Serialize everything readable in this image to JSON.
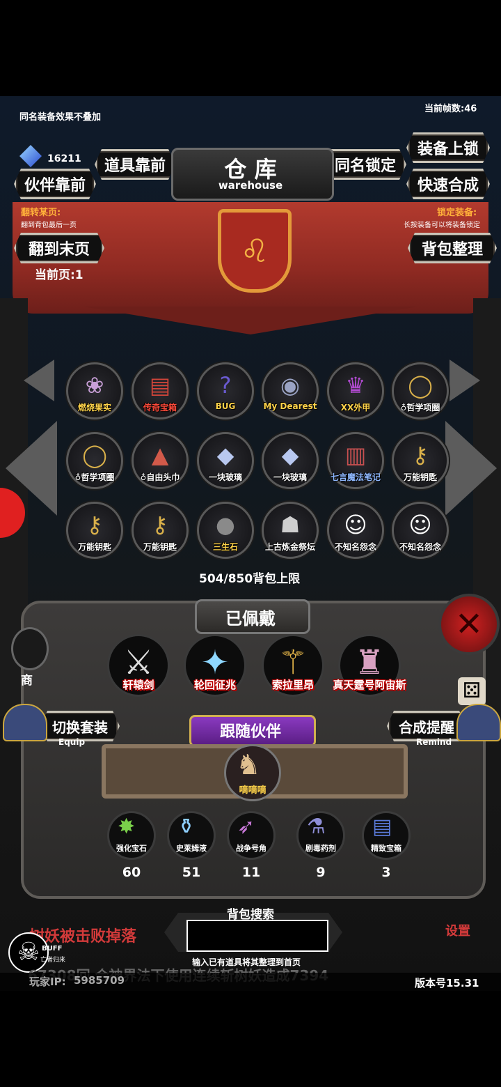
{
  "hud": {
    "note": "同名装备效果不叠加",
    "fps": "当前帧数:46",
    "gem_count": "16211",
    "flip_title": "翻转某页:",
    "flip_desc": "翻到背包最后一页",
    "lock_title": "锁定装备:",
    "lock_desc": "长按装备可以将装备锁定",
    "current_page": "当前页:1",
    "capacity": "504/850背包上限",
    "shop_label": "商",
    "settings_label": "设置",
    "buff_label": "BUFF",
    "buff_sub": "亡者归来",
    "drop_text": "树妖被击败掉落",
    "scroll_text": "67308回 合神界法下使用连续斩树妖造成7394",
    "player_ip_label": "玩家IP:",
    "player_ip": "5985709",
    "version": "版本号15.31"
  },
  "title": {
    "cn": "仓 库",
    "en": "warehouse"
  },
  "buttons": {
    "item_front": "道具靠前",
    "partner_front": "伙伴靠前",
    "same_lock": "同名锁定",
    "equip_lock": "装备上锁",
    "quick_merge": "快速合成",
    "last_page": "翻到末页",
    "sort_bag": "背包整理",
    "switch_set": "切换套装",
    "switch_set_sub": "Equip",
    "merge_remind": "合成提醒",
    "merge_remind_sub": "Remind",
    "follow_partner": "跟随伙伴",
    "equipped": "已佩戴",
    "search_title": "背包搜索",
    "search_hint": "输入已有道具将其整理到首页"
  },
  "inventory": [
    {
      "label": "燃烧果实",
      "icon": "❀",
      "color": "#c9a0d8",
      "label_color": "#ffd34a"
    },
    {
      "label": "传奇宝箱",
      "icon": "▤",
      "color": "#d2453a",
      "label_color": "#ff4a3a"
    },
    {
      "label": "BUG",
      "icon": "?",
      "color": "#6a5ad0",
      "label_color": "#ffd34a"
    },
    {
      "label": "My Dearest",
      "icon": "◉",
      "color": "#9aa3c4",
      "label_color": "#ffd34a"
    },
    {
      "label": "XX外甲",
      "icon": "♛",
      "color": "#b04ad0",
      "label_color": "#ffd34a"
    },
    {
      "label": "♁哲学项圈",
      "icon": "◯",
      "color": "#d9b04a",
      "label_color": "#ffffff"
    },
    {
      "label": "♁哲学项圈",
      "icon": "◯",
      "color": "#d9b04a",
      "label_color": "#ffffff"
    },
    {
      "label": "♁自由头巾",
      "icon": "▲",
      "color": "#d25a4a",
      "label_color": "#ffffff"
    },
    {
      "label": "一块玻璃",
      "icon": "◆",
      "color": "#b8c8f0",
      "label_color": "#ffffff"
    },
    {
      "label": "一块玻璃",
      "icon": "◆",
      "color": "#b8c8f0",
      "label_color": "#ffffff"
    },
    {
      "label": "七言魔法笔记",
      "icon": "▥",
      "color": "#c85050",
      "label_color": "#8fb8ff"
    },
    {
      "label": "万能钥匙",
      "icon": "⚷",
      "color": "#d9b04a",
      "label_color": "#ffffff"
    },
    {
      "label": "万能钥匙",
      "icon": "⚷",
      "color": "#d9b04a",
      "label_color": "#ffffff"
    },
    {
      "label": "万能钥匙",
      "icon": "⚷",
      "color": "#d9b04a",
      "label_color": "#ffffff"
    },
    {
      "label": "三生石",
      "icon": "●",
      "color": "#8a8a8a",
      "label_color": "#ffd34a"
    },
    {
      "label": "上古炼金祭坛",
      "icon": "☗",
      "color": "#cfcfcf",
      "label_color": "#ffffff"
    },
    {
      "label": "不知名怨念",
      "icon": "☺",
      "color": "#ffffff",
      "label_color": "#ffffff"
    },
    {
      "label": "不知名怨念",
      "icon": "☺",
      "color": "#ffffff",
      "label_color": "#ffffff"
    }
  ],
  "equipped": [
    {
      "label": "轩辕剑",
      "icon": "⚔",
      "color": "#dcdcdc"
    },
    {
      "label": "轮回征兆",
      "icon": "✦",
      "color": "#8fd8ff"
    },
    {
      "label": "索拉里昂",
      "icon": "⚚",
      "color": "#e8b84a"
    },
    {
      "label": "真天霆号阿宙斯",
      "icon": "♜",
      "color": "#d8a0c0"
    }
  ],
  "partner": {
    "label": "嘀嘀嘀",
    "icon": "♞"
  },
  "consumables": [
    {
      "label": "强化宝石",
      "icon": "✸",
      "color": "#7ad04a",
      "count": "60"
    },
    {
      "label": "史莱姆液",
      "icon": "⚱",
      "color": "#8fd0ff",
      "count": "51"
    },
    {
      "label": "战争号角",
      "icon": "➶",
      "color": "#c878d8",
      "count": "11"
    },
    {
      "label": "剧毒药剂",
      "icon": "⚗",
      "color": "#8f8fd8",
      "count": "9"
    },
    {
      "label": "精致宝箱",
      "icon": "▤",
      "color": "#5a7ad8",
      "count": "3"
    }
  ]
}
